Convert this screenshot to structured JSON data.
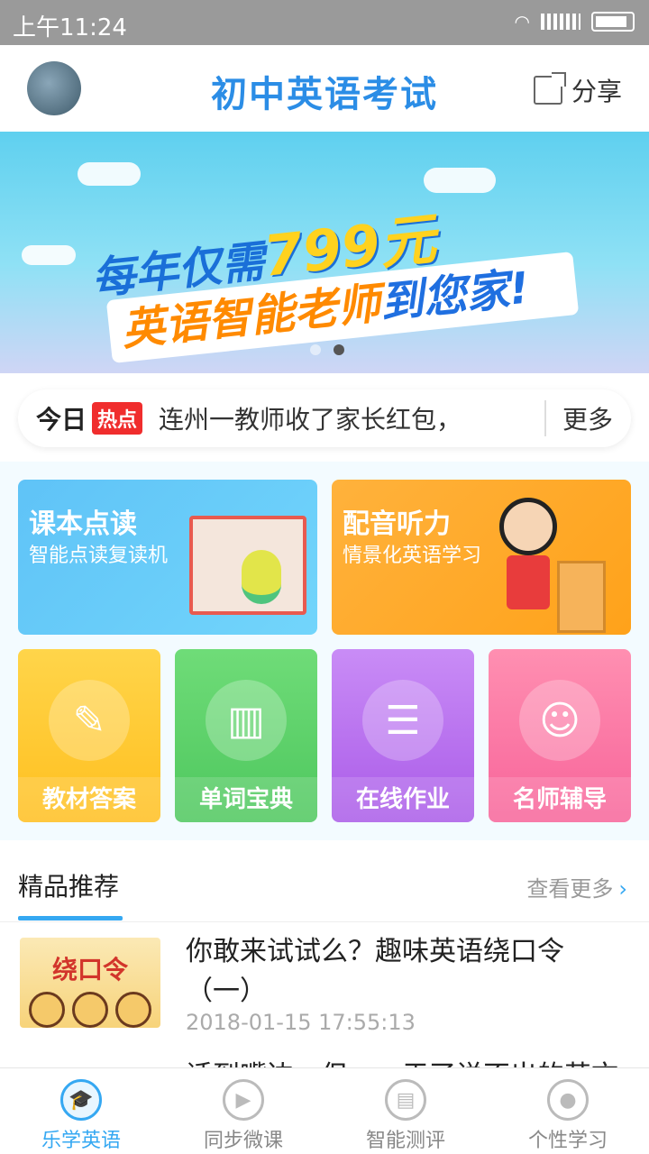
{
  "status_bar": {
    "time": "上午11:24"
  },
  "header": {
    "title": "初中英语考试",
    "share_label": "分享"
  },
  "banner": {
    "line1_prefix": "每年仅需",
    "line1_price": "799元",
    "line2_orange": "英语智能老师",
    "line2_blue": "到您家!"
  },
  "news": {
    "today": "今日",
    "hot": "热点",
    "headline": "连州一教师收了家长红包，",
    "more": "更多"
  },
  "feature_cards": [
    {
      "title": "课本点读",
      "subtitle": "智能点读复读机"
    },
    {
      "title": "配音听力",
      "subtitle": "情景化英语学习"
    }
  ],
  "tiles": [
    {
      "label": "教材答案",
      "icon": "document-pen-icon"
    },
    {
      "label": "单词宝典",
      "icon": "open-book-icon"
    },
    {
      "label": "在线作业",
      "icon": "checklist-pen-icon"
    },
    {
      "label": "名师辅导",
      "icon": "teacher-icon"
    }
  ],
  "recommend": {
    "title": "精品推荐",
    "more": "查看更多"
  },
  "articles": [
    {
      "thumb_text": "绕口令",
      "title": "你敢来试试么？趣味英语绕口令（一）",
      "date": "2018-01-15 17:55:13"
    },
    {
      "title": "话到嘴边，但……于了说不出的英文句"
    }
  ],
  "tabbar": [
    {
      "label": "乐学英语",
      "active": true
    },
    {
      "label": "同步微课",
      "active": false
    },
    {
      "label": "智能测评",
      "active": false
    },
    {
      "label": "个性学习",
      "active": false
    }
  ],
  "colors": {
    "accent": "#35a8f2",
    "hot": "#f02d2d"
  }
}
